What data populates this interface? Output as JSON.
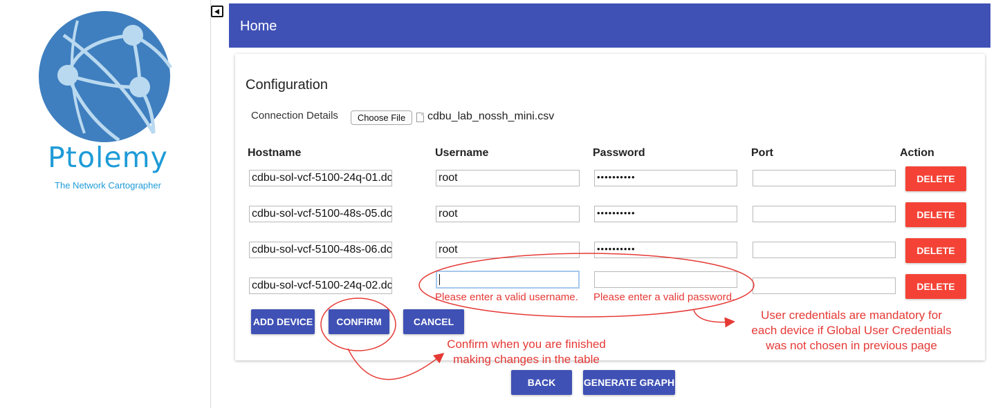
{
  "brand": {
    "name": "Ptolemy",
    "tagline": "The Network Cartographer"
  },
  "header": {
    "title": "Home"
  },
  "configuration": {
    "title": "Configuration",
    "connection_label": "Connection Details",
    "choose_file_label": "Choose File",
    "file_name": "cdbu_lab_nossh_mini.csv"
  },
  "table": {
    "columns": [
      "Hostname",
      "Username",
      "Password",
      "Port",
      "Action"
    ],
    "rows": [
      {
        "hostname": "cdbu-sol-vcf-5100-24q-01.dc",
        "username": "root",
        "password": "••••••••••",
        "port": "",
        "action": "DELETE"
      },
      {
        "hostname": "cdbu-sol-vcf-5100-48s-05.dc",
        "username": "root",
        "password": "••••••••••",
        "port": "",
        "action": "DELETE"
      },
      {
        "hostname": "cdbu-sol-vcf-5100-48s-06.dc",
        "username": "root",
        "password": "••••••••••",
        "port": "",
        "action": "DELETE"
      },
      {
        "hostname": "cdbu-sol-vcf-5100-24q-02.dc",
        "username": "",
        "password": "",
        "port": "",
        "action": "DELETE"
      }
    ],
    "errors": {
      "username": "Please enter a valid username.",
      "password": "Please enter a valid password."
    }
  },
  "buttons": {
    "add_device": "ADD DEVICE",
    "confirm": "CONFIRM",
    "cancel": "CANCEL",
    "back": "BACK",
    "generate_graph": "GENERATE GRAPH"
  },
  "annotations": {
    "credentials_note": [
      "User credentials are mandatory for",
      "each device if Global User Credentials",
      "was not chosen in previous page"
    ],
    "confirm_note": [
      "Confirm when you are finished",
      "making changes in the table"
    ]
  },
  "colors": {
    "primary": "#3f51b5",
    "danger": "#f44336",
    "brand": "#1e9bd7",
    "annotation": "#e53935"
  }
}
